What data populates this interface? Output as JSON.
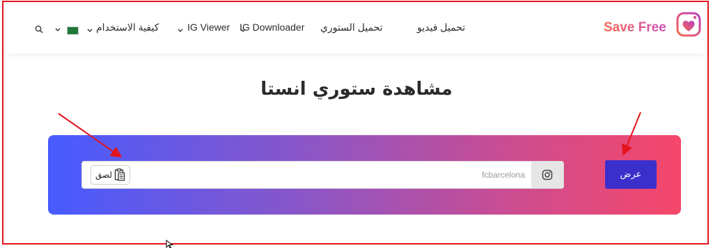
{
  "header": {
    "brand": "Save Free",
    "nav": [
      {
        "label": "تحميل فيديو"
      },
      {
        "label": "تحميل الستوري"
      },
      {
        "label": "IG Downloader"
      },
      {
        "label": "IG Viewer"
      },
      {
        "label": "كيفية الاستخدام"
      }
    ],
    "language_flag": "saudi-flag-icon",
    "search_icon": "search-icon"
  },
  "main": {
    "title": "مشاهدة ستوري انستا",
    "input": {
      "value": "",
      "placeholder": "fcbarcelona"
    },
    "paste_label": "لصق",
    "view_label": "عرض"
  },
  "colors": {
    "frame": "#e3141b",
    "gradient_start": "#475bff",
    "gradient_end": "#f5476a",
    "button": "#3b2fcc"
  }
}
